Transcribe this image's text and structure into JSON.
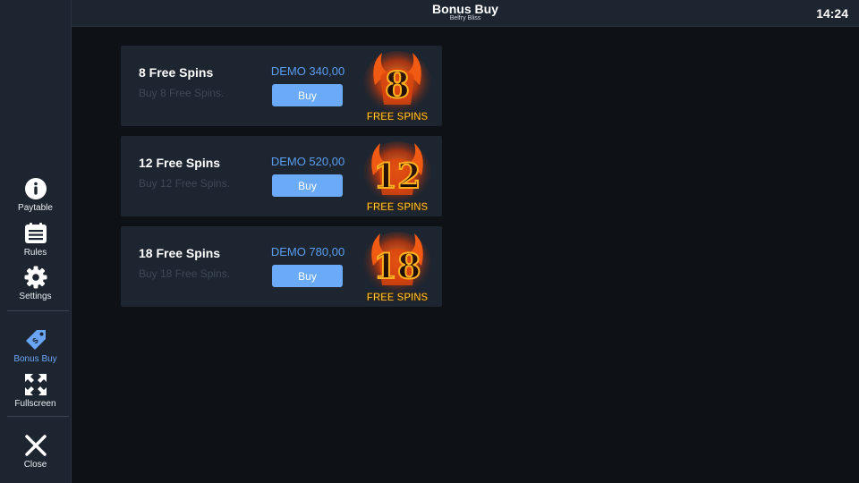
{
  "header": {
    "title": "Bonus Buy",
    "subtitle": "Belfry Bliss",
    "clock": "14:24"
  },
  "sidebar": {
    "paytable_label": "Paytable",
    "rules_label": "Rules",
    "settings_label": "Settings",
    "bonus_buy_label": "Bonus Buy",
    "fullscreen_label": "Fullscreen",
    "close_label": "Close"
  },
  "offers": [
    {
      "title": "8 Free Spins",
      "description": "Buy 8 Free Spins.",
      "price": "DEMO 340,00",
      "button": "Buy",
      "badge_number": "8",
      "badge_text": "FREE SPINS"
    },
    {
      "title": "12 Free Spins",
      "description": "Buy 12 Free Spins.",
      "price": "DEMO 520,00",
      "button": "Buy",
      "badge_number": "12",
      "badge_text": "FREE SPINS"
    },
    {
      "title": "18 Free Spins",
      "description": "Buy 18 Free Spins.",
      "price": "DEMO 780,00",
      "button": "Buy",
      "badge_number": "18",
      "badge_text": "FREE SPINS"
    }
  ],
  "colors": {
    "accent": "#6aaaf7",
    "price": "#5b9ef0",
    "active_tab": "#6aa5f5",
    "badge_text": "#ffd43a"
  }
}
